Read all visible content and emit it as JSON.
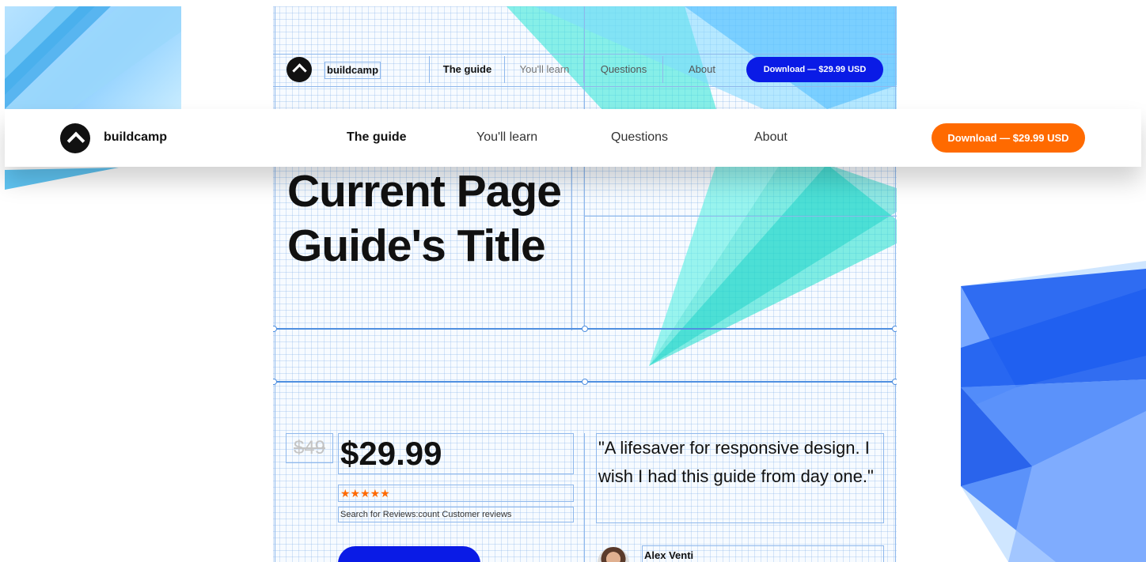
{
  "header": {
    "brand": "buildcamp",
    "nav": [
      "The guide",
      "You'll learn",
      "Questions",
      "About"
    ],
    "active": "The guide",
    "cta": "Download — $29.99 USD"
  },
  "mini_header": {
    "brand": "buildcamp",
    "nav": [
      "The guide",
      "You'll learn",
      "Questions",
      "About"
    ],
    "cta": "Download — $29.99 USD"
  },
  "hero": {
    "title_line1": "Current Page",
    "title_line2": "Guide's Title"
  },
  "pricing": {
    "old_price": "$49",
    "price": "$29.99",
    "stars": "★★★★★",
    "reviews": "Search for Reviews:count Customer reviews"
  },
  "testimonial": {
    "quote": "\"A lifesaver for responsive design. I wish I had this guide from day one.\"",
    "author": "Alex Venti"
  },
  "colors": {
    "accent_orange": "#ff6a00",
    "accent_blue": "#0a1be6",
    "guide_blue": "#8fb8ec"
  }
}
